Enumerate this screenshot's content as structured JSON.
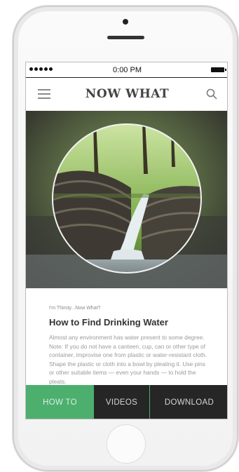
{
  "status_bar": {
    "time": "0:00 PM"
  },
  "header": {
    "title": "NOW WHAT",
    "menu_icon": "hamburger-menu-icon",
    "search_icon": "search-icon"
  },
  "article": {
    "eyebrow": "I'm Thirsty...Now What?",
    "title": "How to Find Drinking Water",
    "body": "Almost any environment has water present to some degree. Note: If you do not have a canteen, cup, can or other type of container, improvise one from plastic or water-resistant cloth. Shape the plastic or cloth into a bowl by pleating it. Use pins or other suitable items — even your hands — to hold the pleats."
  },
  "tabs": [
    {
      "label": "HOW TO",
      "active": true
    },
    {
      "label": "VIDEOS",
      "active": false
    },
    {
      "label": "DOWNLOAD",
      "active": false
    }
  ],
  "colors": {
    "accent": "#4caf6e",
    "tabbar": "#262626",
    "title": "#444444"
  }
}
